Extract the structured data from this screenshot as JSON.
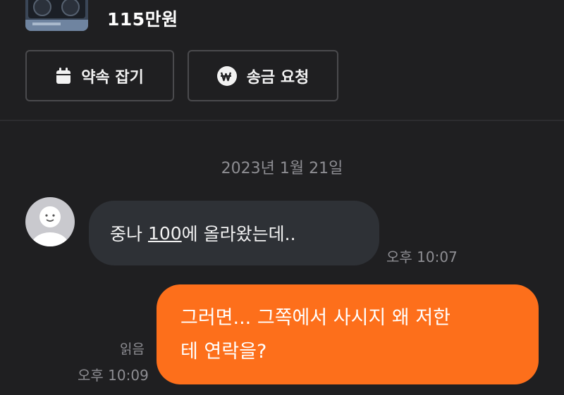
{
  "product": {
    "price": "115만원",
    "thumbnail_icon": "graphics-card-photo"
  },
  "actions": {
    "appointment_label": "약속 잡기",
    "appointment_icon": "calendar-icon",
    "remit_label": "송금 요청",
    "remit_icon": "won-coin-icon"
  },
  "chat": {
    "date_separator": "2023년 1월 21일",
    "messages": [
      {
        "direction": "incoming",
        "text_before": "중나 ",
        "link_text": "100",
        "text_after": "에 올라왔는데..",
        "time": "오후 10:07"
      },
      {
        "direction": "outgoing",
        "line1": "그러면... 그쪽에서 사시지 왜 저한",
        "line2": "테 연락을?",
        "read_status": "읽음",
        "time": "오후 10:09"
      }
    ]
  },
  "colors": {
    "background": "#1f1f21",
    "incoming_bubble": "#2e3136",
    "outgoing_bubble": "#fd6f1b",
    "muted_text": "#8e8e93"
  }
}
